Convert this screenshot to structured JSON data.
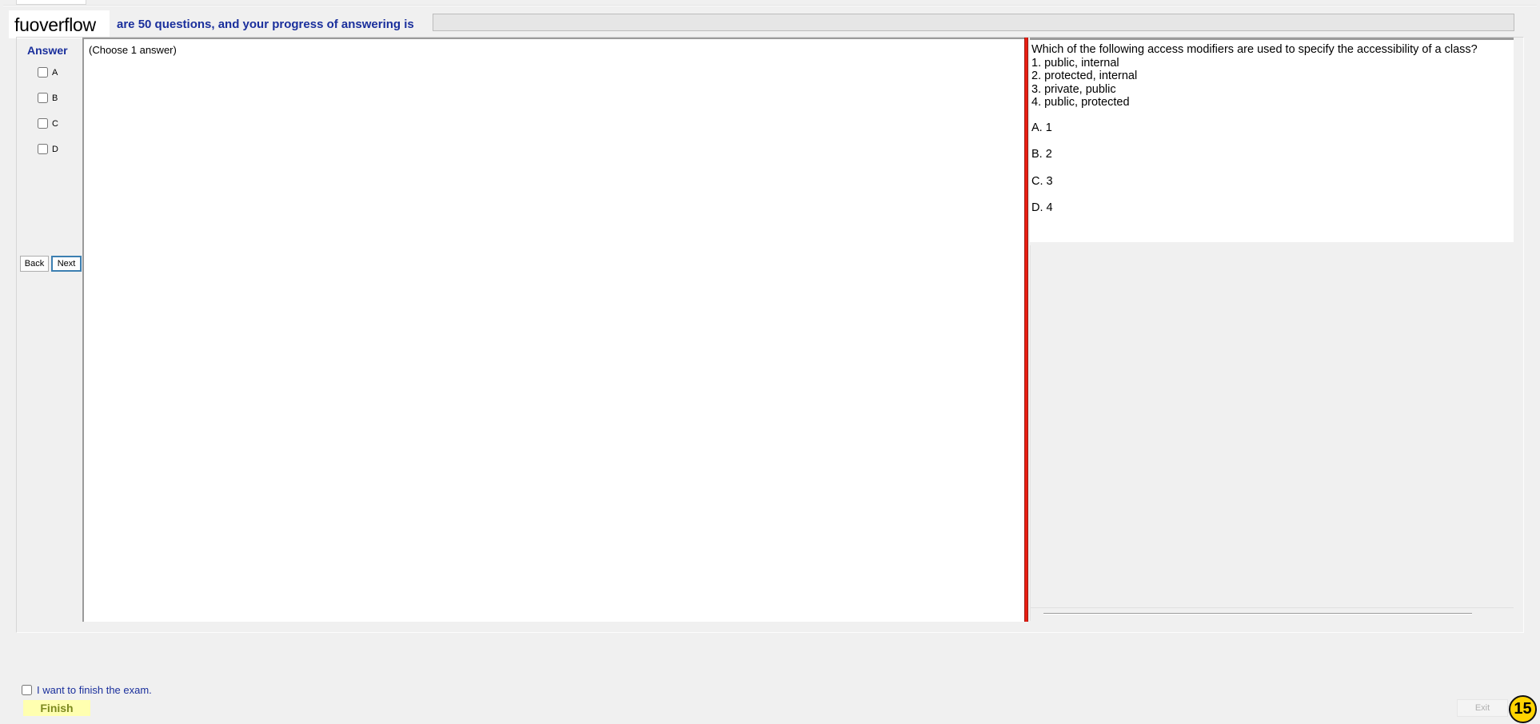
{
  "header": {
    "brand": "fuoverflow",
    "progress_text": "are 50 questions, and your progress of answering is",
    "progress_percent": 0
  },
  "answer_panel": {
    "heading": "Answer",
    "choices": [
      {
        "label": "A",
        "checked": false
      },
      {
        "label": "B",
        "checked": false
      },
      {
        "label": "C",
        "checked": false
      },
      {
        "label": "D",
        "checked": false
      }
    ],
    "back_label": "Back",
    "next_label": "Next"
  },
  "answer_area": {
    "hint": "(Choose 1 answer)"
  },
  "question": {
    "lines": [
      "Which of the following access modifiers are used to specify the accessibility of a class?",
      "1. public, internal",
      "2. protected, internal",
      "3. private, public",
      "4. public, protected"
    ],
    "options": [
      "A.  1",
      "B.  2",
      "C.  3",
      "D.  4"
    ]
  },
  "footer": {
    "finish_check_label": "I want to finish the exam.",
    "finish_label": "Finish",
    "exit_label": "Exit",
    "counter": "15"
  },
  "colors": {
    "accent_text": "#1a2f9c",
    "splitter": "#e81e12",
    "finish_bg": "#ffffb0",
    "counter_bg": "#ffd400"
  }
}
